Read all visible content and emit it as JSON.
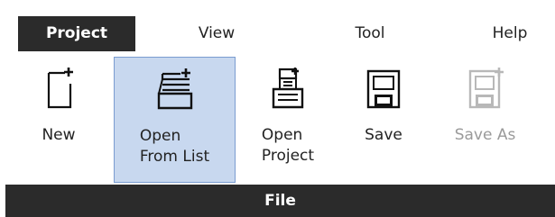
{
  "menu": {
    "tabs": [
      {
        "label": "Project",
        "active": true
      },
      {
        "label": "View",
        "active": false
      },
      {
        "label": "Tool",
        "active": false
      },
      {
        "label": "Help",
        "active": false
      }
    ]
  },
  "ribbon": {
    "buttons": [
      {
        "label": "New",
        "icon": "new-document-icon",
        "enabled": true,
        "selected": false
      },
      {
        "label": "Open\nFrom List",
        "icon": "open-from-list-icon",
        "enabled": true,
        "selected": true
      },
      {
        "label": "Open\nProject",
        "icon": "open-project-icon",
        "enabled": true,
        "selected": false
      },
      {
        "label": "Save",
        "icon": "save-icon",
        "enabled": true,
        "selected": false
      },
      {
        "label": "Save As",
        "icon": "save-as-icon",
        "enabled": false,
        "selected": false
      }
    ],
    "group_label": "File"
  },
  "colors": {
    "dark_bar": "#2b2b2b",
    "selected_bg": "#c8d8ef",
    "selected_border": "#7a9cd0",
    "disabled_text": "#9a9a9a"
  }
}
